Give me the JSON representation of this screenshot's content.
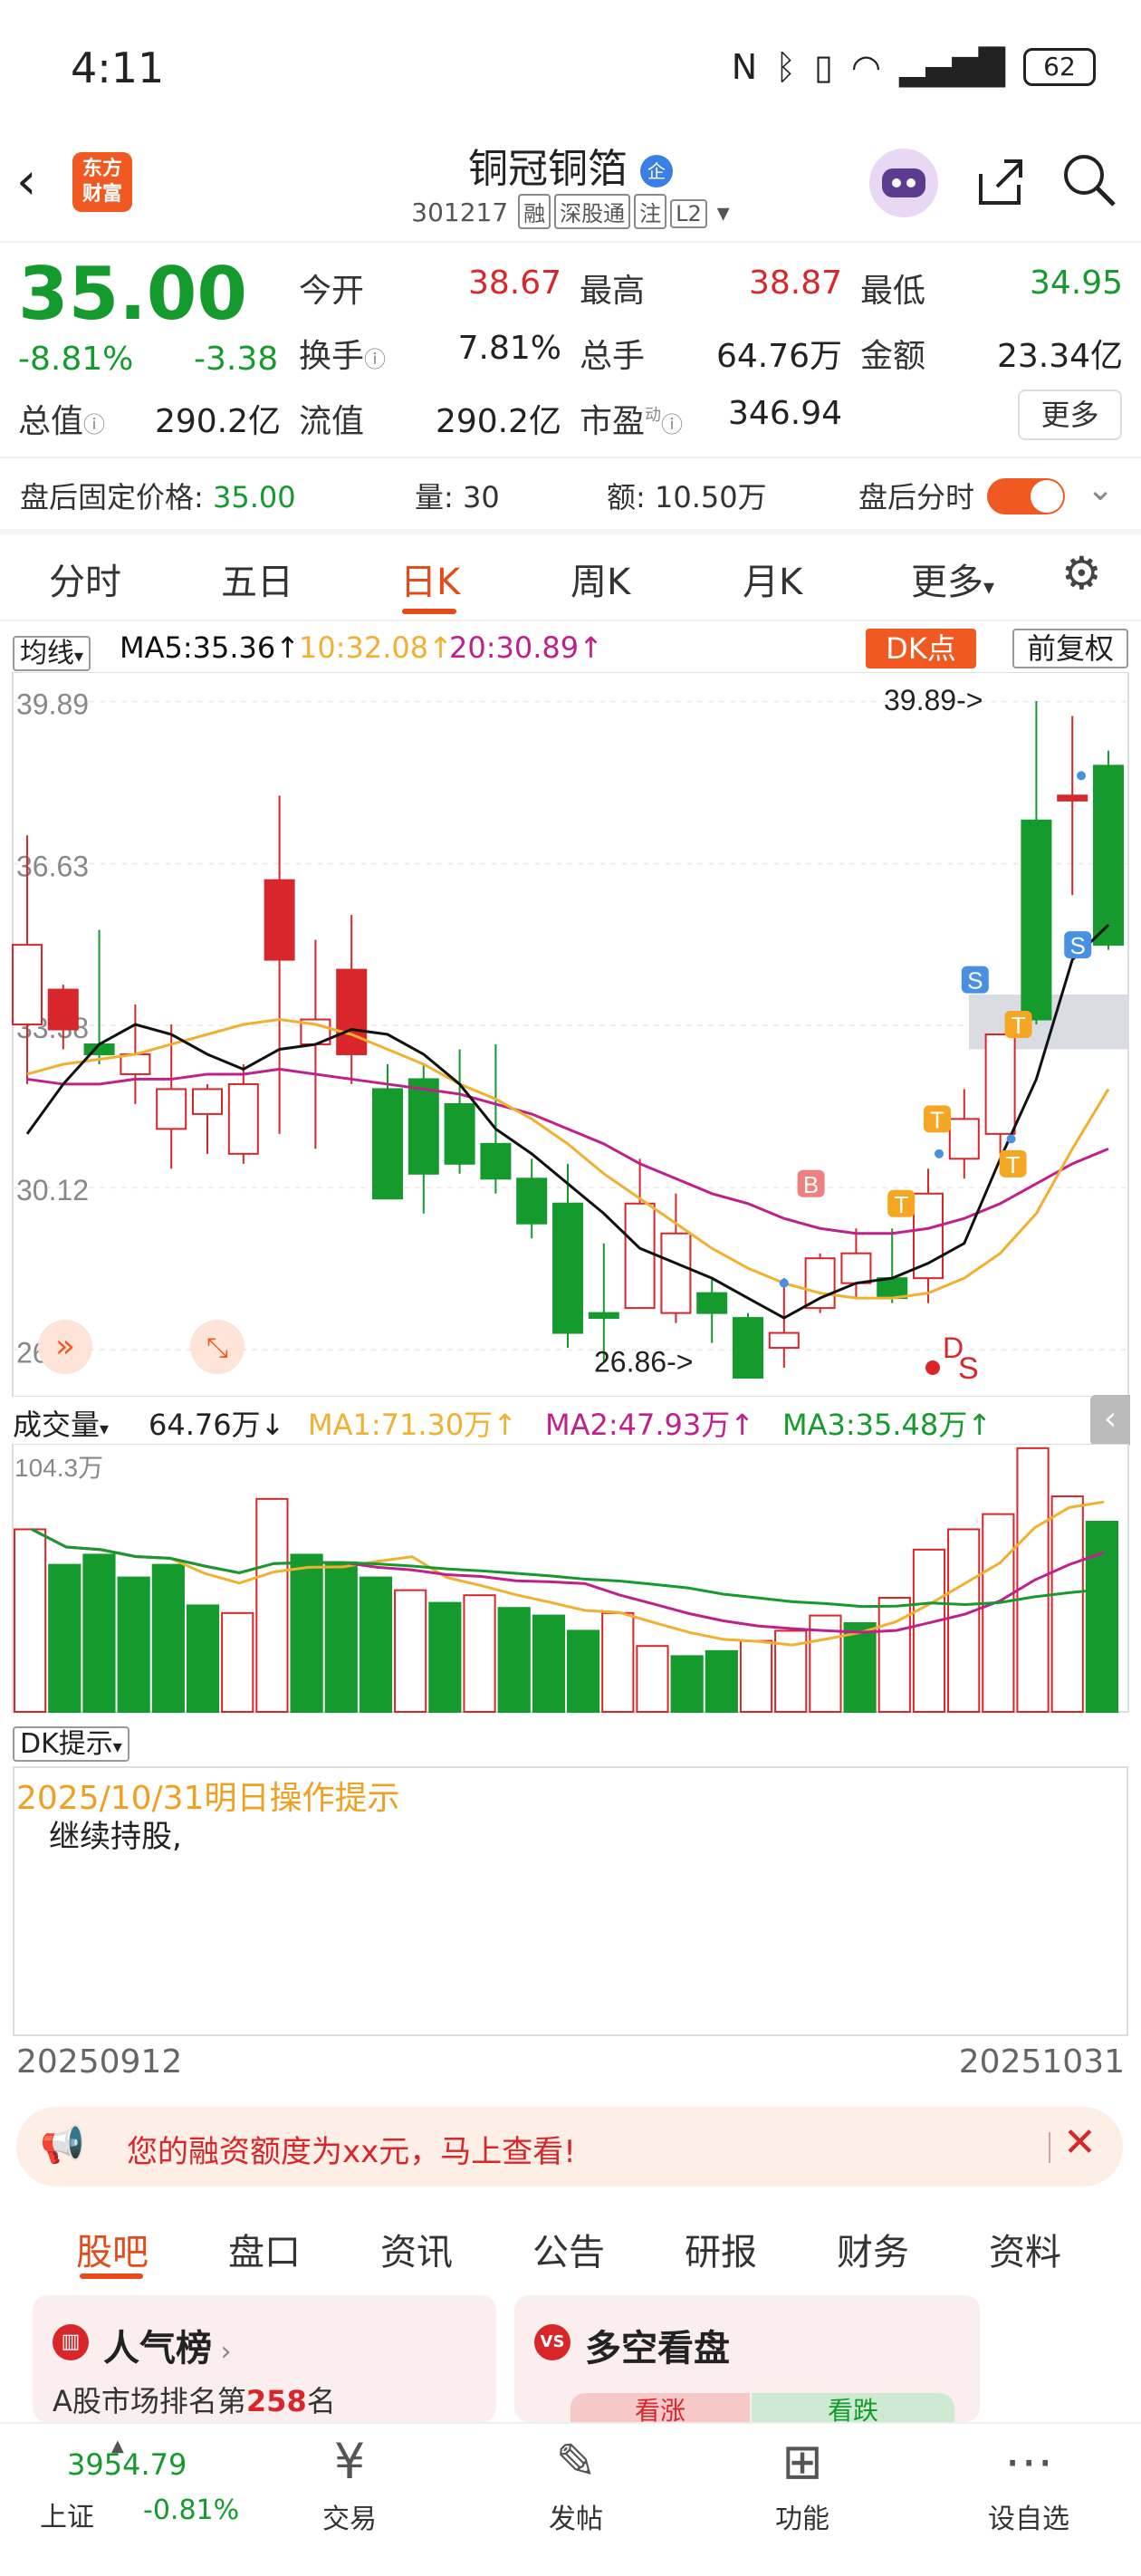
{
  "status": {
    "time": "4:11",
    "battery": "62"
  },
  "header": {
    "title": "铜冠铜箔",
    "title_badge": "企",
    "code": "301217",
    "tags": [
      "融",
      "深股通",
      "注",
      "L2"
    ],
    "logo_text": "东方财富"
  },
  "quote": {
    "price": "35.00",
    "change_pct": "-8.81%",
    "change": "-3.38",
    "items": [
      {
        "label": "今开",
        "value": "38.67",
        "color": "red"
      },
      {
        "label": "最高",
        "value": "38.87",
        "color": "red"
      },
      {
        "label": "最低",
        "value": "34.95",
        "color": "green"
      },
      {
        "label": "换手",
        "value": "7.81%",
        "color": "black"
      },
      {
        "label": "总手",
        "value": "64.76万",
        "color": "black"
      },
      {
        "label": "金额",
        "value": "23.34亿",
        "color": "black"
      },
      {
        "label": "总值",
        "value": "290.2亿",
        "color": "black"
      },
      {
        "label": "流值",
        "value": "290.2亿",
        "color": "black"
      },
      {
        "label": "市盈",
        "value": "346.94",
        "color": "black"
      }
    ],
    "more": "更多",
    "pe_sup": "动"
  },
  "after_hours": {
    "price_label": "盘后固定价格: ",
    "price": "35.00",
    "vol_label": "量: ",
    "vol": "30",
    "amt_label": "额: ",
    "amt": "10.50万",
    "toggle_label": "盘后分时"
  },
  "chart_tabs": [
    "分时",
    "五日",
    "日K",
    "周K",
    "月K",
    "更多"
  ],
  "active_chart_tab": "日K",
  "ma_bar": {
    "selector": "均线",
    "ma5": "MA5:35.36↑",
    "ma10": "10:32.08↑",
    "ma20": "20:30.89↑",
    "dk_button": "DK点",
    "adjust_button": "前复权"
  },
  "volume_bar": {
    "selector": "成交量",
    "vol": "64.76万↓",
    "ma1": "MA1:71.30万↑",
    "ma2": "MA2:47.93万↑",
    "ma3": "MA3:35.48万↑"
  },
  "dk": {
    "selector": "DK提示",
    "date_line": "2025/10/31明日操作提示",
    "text": "继续持股,"
  },
  "date_range": {
    "start": "20250912",
    "end": "20251031"
  },
  "banner": {
    "text": "您的融资额度为xx元，马上查看!"
  },
  "bottom_tabs": [
    "股吧",
    "盘口",
    "资讯",
    "公告",
    "研报",
    "财务",
    "资料"
  ],
  "cards": [
    {
      "title": "人气榜",
      "sub_prefix": "A股市场排名第",
      "rank": "258",
      "sub_suffix": "名"
    },
    {
      "title": "多空看盘",
      "opt1": "看涨",
      "opt2": "看跌"
    }
  ],
  "nav": {
    "index_value": "3954.79",
    "index_name": "上证",
    "index_change": "-0.81%",
    "items": [
      "交易",
      "发帖",
      "功能",
      "设自选"
    ]
  },
  "chart_data": {
    "type": "candlestick",
    "price_axis_labels": [
      "39.89",
      "36.63",
      "33.38",
      "30.12",
      "26.86"
    ],
    "high_marker": "39.89->",
    "low_marker": "26.86->",
    "volume_axis_label": "104.3万",
    "signal_labels": [
      "B",
      "T",
      "S",
      "D"
    ],
    "colors": {
      "up": "#d8262b",
      "down": "#159a2e",
      "ma5": "#111111",
      "ma10": "#f0b030",
      "ma20": "#c0208a"
    },
    "candles": [
      {
        "o": 33.4,
        "h": 37.2,
        "l": 32.2,
        "c": 35.0
      },
      {
        "o": 33.3,
        "h": 34.2,
        "l": 32.9,
        "c": 34.1
      },
      {
        "o": 33.0,
        "h": 35.3,
        "l": 32.6,
        "c": 32.8
      },
      {
        "o": 32.4,
        "h": 33.8,
        "l": 31.8,
        "c": 32.8
      },
      {
        "o": 31.3,
        "h": 33.4,
        "l": 30.5,
        "c": 32.1
      },
      {
        "o": 31.6,
        "h": 32.2,
        "l": 30.8,
        "c": 32.1
      },
      {
        "o": 30.8,
        "h": 32.6,
        "l": 30.6,
        "c": 32.2
      },
      {
        "o": 34.7,
        "h": 38.0,
        "l": 31.2,
        "c": 36.3
      },
      {
        "o": 33.0,
        "h": 35.1,
        "l": 30.9,
        "c": 33.5
      },
      {
        "o": 32.8,
        "h": 35.6,
        "l": 32.2,
        "c": 34.5
      },
      {
        "o": 32.1,
        "h": 32.6,
        "l": 29.9,
        "c": 29.9
      },
      {
        "o": 32.3,
        "h": 32.6,
        "l": 29.6,
        "c": 30.4
      },
      {
        "o": 31.8,
        "h": 32.9,
        "l": 30.4,
        "c": 30.6
      },
      {
        "o": 31.0,
        "h": 33.0,
        "l": 30.0,
        "c": 30.3
      },
      {
        "o": 30.3,
        "h": 30.7,
        "l": 29.1,
        "c": 29.4
      },
      {
        "o": 29.8,
        "h": 30.6,
        "l": 26.9,
        "c": 27.2
      },
      {
        "o": 27.6,
        "h": 29.0,
        "l": 26.6,
        "c": 27.5
      },
      {
        "o": 27.7,
        "h": 30.7,
        "l": 27.7,
        "c": 29.8
      },
      {
        "o": 27.6,
        "h": 30.0,
        "l": 27.4,
        "c": 29.2
      },
      {
        "o": 28.0,
        "h": 28.3,
        "l": 27.0,
        "c": 27.6
      },
      {
        "o": 27.5,
        "h": 27.6,
        "l": 26.3,
        "c": 26.3
      },
      {
        "o": 26.9,
        "h": 28.3,
        "l": 26.5,
        "c": 27.2
      },
      {
        "o": 27.7,
        "h": 28.8,
        "l": 27.6,
        "c": 28.7
      },
      {
        "o": 28.2,
        "h": 29.3,
        "l": 27.9,
        "c": 28.8
      },
      {
        "o": 28.3,
        "h": 29.3,
        "l": 27.8,
        "c": 27.9
      },
      {
        "o": 28.3,
        "h": 30.5,
        "l": 27.8,
        "c": 30.0
      },
      {
        "o": 30.7,
        "h": 32.1,
        "l": 30.3,
        "c": 31.5
      },
      {
        "o": 31.2,
        "h": 33.2,
        "l": 30.8,
        "c": 33.2
      },
      {
        "o": 37.5,
        "h": 39.9,
        "l": 33.4,
        "c": 33.5
      },
      {
        "o": 37.9,
        "h": 39.6,
        "l": 36.0,
        "c": 38.0
      },
      {
        "o": 38.6,
        "h": 38.9,
        "l": 34.9,
        "c": 35.0
      }
    ],
    "volumes": [
      72,
      58,
      62,
      53,
      58,
      42,
      39,
      84,
      62,
      59,
      53,
      48,
      43,
      46,
      41,
      38,
      32,
      39,
      26,
      22,
      24,
      28,
      32,
      38,
      35,
      45,
      64,
      72,
      78,
      104,
      85,
      75
    ],
    "volume_up": [
      true,
      false,
      false,
      false,
      false,
      false,
      true,
      true,
      false,
      false,
      false,
      true,
      false,
      true,
      false,
      false,
      false,
      true,
      true,
      false,
      false,
      true,
      true,
      true,
      false,
      true,
      true,
      true,
      true,
      true,
      true,
      false
    ],
    "ma5": [
      31.2,
      32.2,
      33.0,
      33.4,
      33.2,
      32.8,
      32.5,
      32.9,
      33.0,
      33.3,
      33.2,
      32.8,
      32.2,
      31.3,
      30.8,
      30.2,
      29.6,
      28.9,
      28.6,
      28.3,
      27.9,
      27.5,
      27.9,
      28.2,
      28.3,
      28.6,
      29.0,
      30.7,
      32.3,
      34.7,
      35.4
    ],
    "ma10": [
      32.4,
      32.6,
      32.7,
      32.8,
      33.0,
      33.2,
      33.4,
      33.5,
      33.4,
      33.2,
      32.9,
      32.6,
      32.2,
      31.9,
      31.5,
      31.0,
      30.4,
      29.9,
      29.4,
      28.9,
      28.5,
      28.2,
      28.0,
      27.9,
      27.9,
      28.0,
      28.3,
      28.8,
      29.6,
      30.9,
      32.1
    ],
    "ma20": [
      32.3,
      32.2,
      32.2,
      32.3,
      32.3,
      32.4,
      32.4,
      32.5,
      32.4,
      32.3,
      32.2,
      32.1,
      32.0,
      31.8,
      31.6,
      31.3,
      31.0,
      30.6,
      30.3,
      30.0,
      29.8,
      29.5,
      29.3,
      29.2,
      29.2,
      29.3,
      29.5,
      29.8,
      30.2,
      30.6,
      30.9
    ]
  }
}
